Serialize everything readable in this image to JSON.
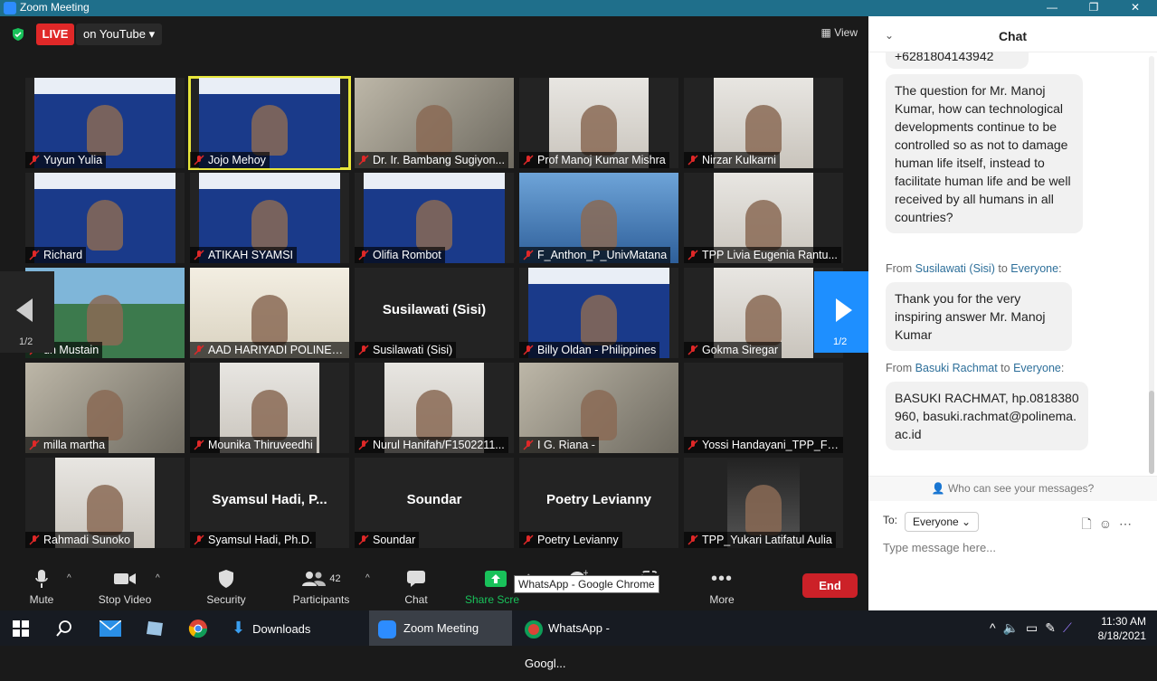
{
  "window": {
    "title": "Zoom Meeting"
  },
  "topbar": {
    "live_label": "LIVE",
    "stream_label": "on YouTube",
    "view_label": "View"
  },
  "participants": [
    {
      "name": "Yuyun Yulia",
      "kind": "conf"
    },
    {
      "name": "Jojo Mehoy",
      "kind": "conf",
      "active": true
    },
    {
      "name": "Dr. Ir. Bambang Sugiyon...",
      "kind": "room"
    },
    {
      "name": "Prof Manoj Kumar Mishra",
      "kind": "person"
    },
    {
      "name": "Nirzar Kulkarni",
      "kind": "person"
    },
    {
      "name": "Richard",
      "kind": "conf"
    },
    {
      "name": "ATIKAH SYAMSI",
      "kind": "conf"
    },
    {
      "name": "Olifia Rombot",
      "kind": "conf"
    },
    {
      "name": "F_Anthon_P_UnivMatana",
      "kind": "building"
    },
    {
      "name": "TPP Livia Eugenia Rantu...",
      "kind": "person"
    },
    {
      "name": "un Mustain",
      "kind": "outdoor"
    },
    {
      "name": "AAD HARIYADI POLINEMA",
      "kind": "poster"
    },
    {
      "name": "Susilawati (Sisi)",
      "kind": "none",
      "center": "Susilawati (Sisi)"
    },
    {
      "name": "Billy Oldan - Philippines",
      "kind": "conf"
    },
    {
      "name": "Gokma Siregar",
      "kind": "person"
    },
    {
      "name": "milla martha",
      "kind": "room"
    },
    {
      "name": "Mounika Thiruveedhi",
      "kind": "person"
    },
    {
      "name": "Nurul Hanifah/F1502211...",
      "kind": "person"
    },
    {
      "name": "I G. Riana -",
      "kind": "room"
    },
    {
      "name": "Yossi Handayani_TPP_F1...",
      "kind": "none",
      "center": ""
    },
    {
      "name": "Rahmadi Sunoko",
      "kind": "person"
    },
    {
      "name": "Syamsul Hadi, Ph.D.",
      "kind": "none",
      "center": "Syamsul Hadi, P..."
    },
    {
      "name": "Soundar",
      "kind": "none",
      "center": "Soundar"
    },
    {
      "name": "Poetry Levianny",
      "kind": "none",
      "center": "Poetry Levianny"
    },
    {
      "name": "TPP_Yukari Latifatul Aulia",
      "kind": "night"
    }
  ],
  "paging": {
    "left": "1/2",
    "right": "1/2"
  },
  "toolbar": {
    "mute": "Mute",
    "stop_video": "Stop Video",
    "security": "Security",
    "participants": "Participants",
    "participants_count": "42",
    "chat": "Chat",
    "share": "Share Scre",
    "more": "More",
    "end": "End",
    "tooltip": "WhatsApp - Google Chrome"
  },
  "chat": {
    "title": "Chat",
    "partial_top": "+6281804143942",
    "messages": [
      {
        "text": "The question for Mr. Manoj Kumar, how can technological developments continue to be controlled so as not to damage human life itself, instead to facilitate human life and be well received by all humans in all countries?"
      },
      {
        "from": "Susilawati (Sisi)",
        "to": "Everyone",
        "text": "Thank you for the very inspiring answer Mr. Manoj Kumar"
      },
      {
        "from": "Basuki Rachmat",
        "to": "Everyone",
        "text": "BASUKI RACHMAT, hp.0818380960, basuki.rachmat@polinema.ac.id"
      }
    ],
    "from_word": "From",
    "to_word": "to",
    "who_can_see": "Who can see your messages?",
    "to_label": "To:",
    "to_value": "Everyone",
    "placeholder": "Type message here..."
  },
  "taskbar": {
    "downloads": "Downloads",
    "zoom": "Zoom Meeting",
    "whatsapp": "WhatsApp - Googl...",
    "time": "11:30 AM",
    "date": "8/18/2021"
  }
}
